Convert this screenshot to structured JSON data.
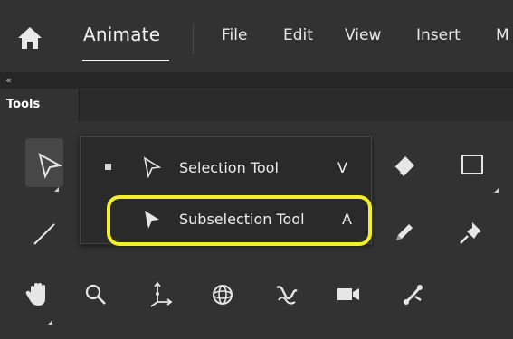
{
  "app": {
    "title": "Animate"
  },
  "menu": {
    "items": [
      "File",
      "Edit",
      "View",
      "Insert",
      "M"
    ]
  },
  "panel": {
    "title": "Tools"
  },
  "flyout": {
    "items": [
      {
        "label": "Selection Tool",
        "shortcut": "V",
        "icon": "selection-arrow-outline-icon",
        "active": true
      },
      {
        "label": "Subselection Tool",
        "shortcut": "A",
        "icon": "subselection-arrow-filled-icon",
        "active": false
      }
    ]
  },
  "tools": [
    "selection-tool-icon",
    "eraser-tool-icon",
    "rectangle-tool-icon",
    "line-tool-icon",
    "pencil-tool-icon",
    "pin-tool-icon",
    "hand-tool-icon",
    "zoom-tool-icon",
    "asset-warp-tool-icon",
    "3d-rotation-tool-icon",
    "bone-tool-icon",
    "camera-tool-icon",
    "pose-tool-icon"
  ],
  "colors": {
    "highlight": "#f2f02a",
    "background": "#323232",
    "text": "#e6e6e6"
  }
}
